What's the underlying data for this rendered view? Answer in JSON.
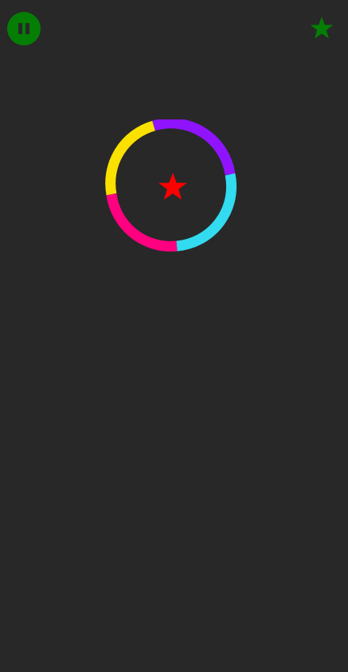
{
  "colors": {
    "background": "#282828",
    "ui_accent": "#047E04",
    "collectible_star": "#FF0000",
    "ring_segments": [
      "#9013FE",
      "#32DBF0",
      "#FF0080",
      "#FAE100"
    ]
  },
  "hud": {
    "pause_icon": "pause-icon",
    "star_icon": "star-icon"
  },
  "play_area": {
    "obstacle": "color-ring",
    "collectible": "star-icon"
  }
}
